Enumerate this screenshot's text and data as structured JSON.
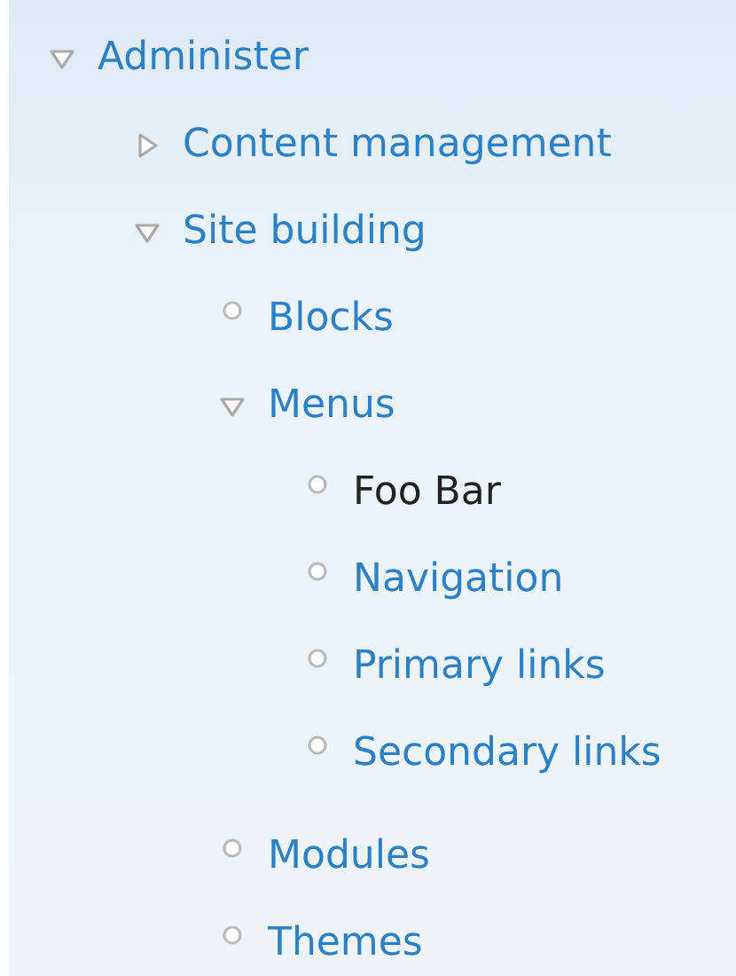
{
  "menu": [
    {
      "label": "Administer",
      "kind": "expanded",
      "selected": false,
      "children": [
        {
          "label": "Content management",
          "kind": "collapsed",
          "selected": false
        },
        {
          "label": "Site building",
          "kind": "expanded",
          "selected": false,
          "children": [
            {
              "label": "Blocks",
              "kind": "leaf",
              "selected": false
            },
            {
              "label": "Menus",
              "kind": "expanded",
              "selected": false,
              "children": [
                {
                  "label": "Foo Bar",
                  "kind": "leaf",
                  "selected": true
                },
                {
                  "label": "Navigation",
                  "kind": "leaf",
                  "selected": false
                },
                {
                  "label": "Primary links",
                  "kind": "leaf",
                  "selected": false
                },
                {
                  "label": "Secondary links",
                  "kind": "leaf",
                  "selected": false
                }
              ]
            },
            {
              "label": "Modules",
              "kind": "leaf",
              "selected": false
            },
            {
              "label": "Themes",
              "kind": "leaf",
              "selected": false
            }
          ]
        }
      ]
    }
  ]
}
